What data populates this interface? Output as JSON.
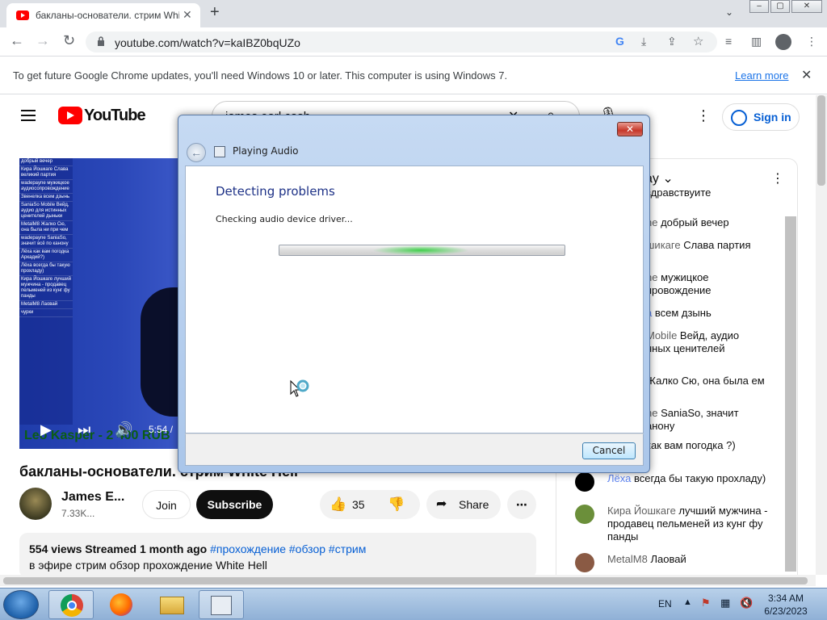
{
  "browser": {
    "tab_title": "бакланы-основатели. стрим White Hell",
    "url": "youtube.com/watch?v=kaIBZ0bqUZo"
  },
  "infobar": {
    "message": "To get future Google Chrome updates, you'll need Windows 10 or later. This computer is using Windows 7.",
    "link": "Learn more"
  },
  "youtube": {
    "logo_text": "YouTube",
    "search_value": "james earl cash",
    "sign_in": "Sign in"
  },
  "video": {
    "time": "5:54 /",
    "banner": "Leo Kasper - 2 400 RUB",
    "title": "бакланы-основатели. стрим White Hell",
    "channel": "James E...",
    "subscribers": "7.33K...",
    "join": "Join",
    "subscribe": "Subscribe",
    "likes": "35",
    "share": "Share",
    "stats": "554 views  Streamed 1 month ago",
    "tags": "#прохождение #обзор #стрим",
    "description": "в эфире стрим обзор прохождение White Hell"
  },
  "overlay_chat": [
    "добрый вечер",
    "Кира Йошкаге Слава великий партия",
    "wadepayne мужицкое аудиосопровождение",
    "Звенелка всем дзынь",
    "SaniaSo Mobile Вейд, аудио для истинных ценителей дыньки",
    "MetalM8 Жалко Сю, она была ни при чем",
    "wadepayne SaniaSo, значит всё по канону",
    "Лёха как вам погодка Аркадий?)",
    "Лёха всегда бы такую прохладу)",
    "Кира Йошкаге лучший мужчина - продавец пельменей из кунг фу панды",
    "MetalM8 Лаовай",
    "чурки"
  ],
  "chat": {
    "header": "ay",
    "messages": [
      {
        "author": "",
        "text": "здравствуйте"
      },
      {
        "author": "ne",
        "text": "добрый вечер"
      },
      {
        "author": "шикаге",
        "text": "Слава партия"
      },
      {
        "author": "ne",
        "text": "мужицкое провождение"
      },
      {
        "author": "а",
        "text": "всем дзынь"
      },
      {
        "author": "Mobile",
        "text": "Вейд, аудио нных ценителей"
      },
      {
        "author": "",
        "text": "Жалко Сю, она была ем"
      },
      {
        "author": "ne",
        "text": "SaniaSo, значит анону"
      },
      {
        "author": "",
        "text": "как вам погодка ?)"
      },
      {
        "author": "Лёха",
        "text": "всегда бы такую прохладу)"
      },
      {
        "author": "Кира Йошкаге",
        "text": "лучший мужчина - продавец пельменей из кунг фу панды"
      },
      {
        "author": "MetalM8",
        "text": "Лаовай"
      }
    ]
  },
  "dialog": {
    "title": "Playing Audio",
    "heading": "Detecting problems",
    "status": "Checking audio device driver...",
    "cancel": "Cancel",
    "close": "✕"
  },
  "taskbar": {
    "lang": "EN",
    "time": "3:34 AM",
    "date": "6/23/2023"
  }
}
